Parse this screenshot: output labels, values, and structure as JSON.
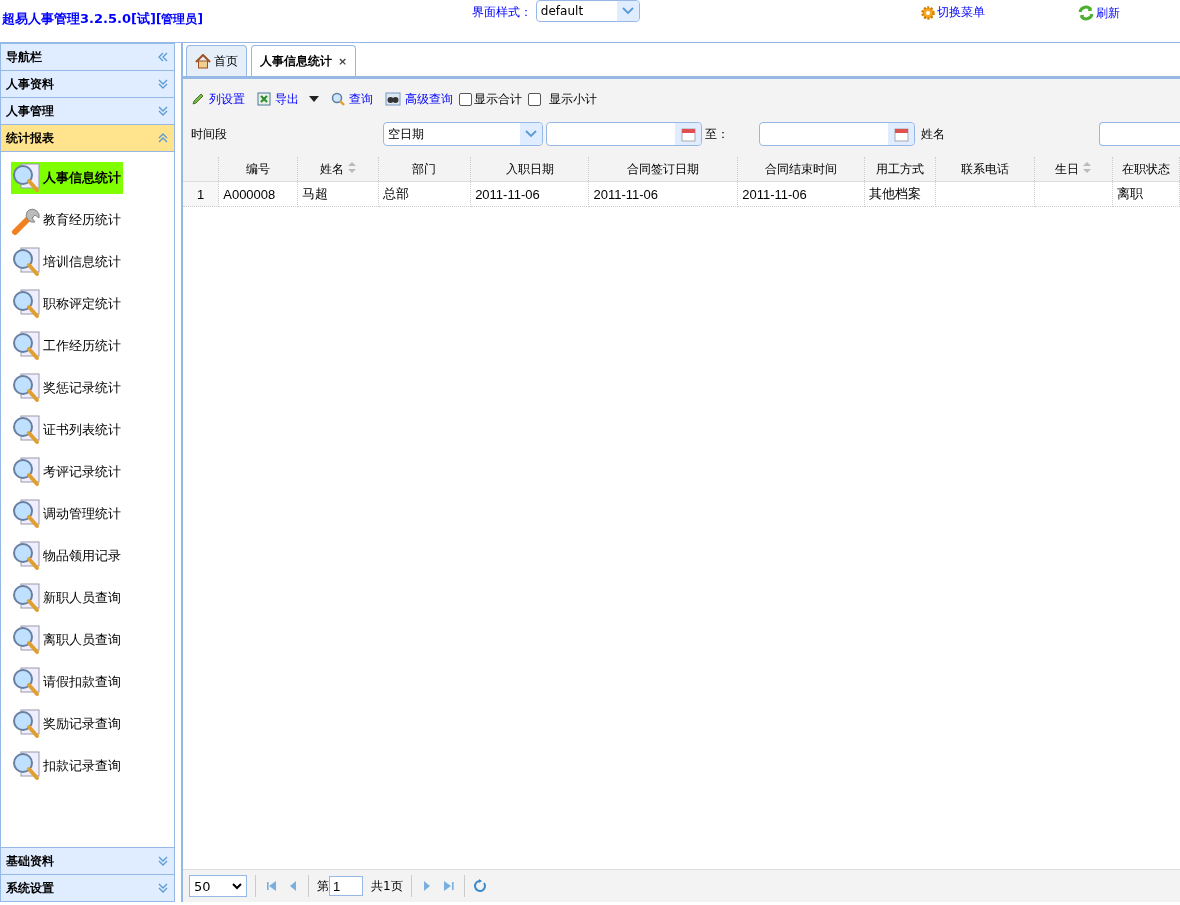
{
  "header": {
    "title": "超易人事管理3.2.5.0[试]",
    "role": "[管理员]",
    "style_label": "界面样式：",
    "style_value": "default",
    "links": [
      {
        "kind": "gear",
        "label": "切换菜单"
      },
      {
        "kind": "refresh",
        "label": "刷新"
      }
    ]
  },
  "sidebar": {
    "title": "导航栏",
    "panels_top": [
      {
        "label": "人事资料",
        "expanded": false
      },
      {
        "label": "人事管理",
        "expanded": false
      },
      {
        "label": "统计报表",
        "expanded": true
      }
    ],
    "items": [
      {
        "label": "人事信息统计",
        "kind": "search",
        "selected": true
      },
      {
        "label": "教育经历统计",
        "kind": "wrench",
        "selected": false
      },
      {
        "label": "培训信息统计",
        "kind": "search",
        "selected": false
      },
      {
        "label": "职称评定统计",
        "kind": "search",
        "selected": false
      },
      {
        "label": "工作经历统计",
        "kind": "search",
        "selected": false
      },
      {
        "label": "奖惩记录统计",
        "kind": "search",
        "selected": false
      },
      {
        "label": "证书列表统计",
        "kind": "search",
        "selected": false
      },
      {
        "label": "考评记录统计",
        "kind": "search",
        "selected": false
      },
      {
        "label": "调动管理统计",
        "kind": "search",
        "selected": false
      },
      {
        "label": "物品领用记录",
        "kind": "search",
        "selected": false
      },
      {
        "label": "新职人员查询",
        "kind": "search",
        "selected": false
      },
      {
        "label": "离职人员查询",
        "kind": "search",
        "selected": false
      },
      {
        "label": "请假扣款查询",
        "kind": "search",
        "selected": false
      },
      {
        "label": "奖励记录查询",
        "kind": "search",
        "selected": false
      },
      {
        "label": "扣款记录查询",
        "kind": "search",
        "selected": false
      }
    ],
    "panels_bottom": [
      {
        "label": "基础资料",
        "expanded": false
      },
      {
        "label": "系统设置",
        "expanded": false
      }
    ]
  },
  "tabs": [
    {
      "label": "首页",
      "kind": "home",
      "selected": false
    },
    {
      "label": "人事信息统计",
      "kind": "plain",
      "selected": true,
      "close": "×"
    }
  ],
  "toolbar": {
    "buttons": [
      {
        "kind": "pencil",
        "label": "列设置"
      },
      {
        "kind": "excel",
        "label": "导出",
        "dropdown": true
      },
      {
        "kind": "search",
        "label": "查询"
      },
      {
        "kind": "binoculars",
        "label": "高级查询"
      }
    ],
    "checkboxes": [
      {
        "label": "显示合计",
        "checked": false
      },
      {
        "label": "显示小计",
        "checked": false
      }
    ]
  },
  "filters": {
    "period_label": "时间段",
    "period_value": "空日期",
    "to_label": "至：",
    "name_label": "姓名"
  },
  "table": {
    "columns": [
      {
        "label": "编号",
        "sortable": false
      },
      {
        "label": "姓名",
        "sortable": true
      },
      {
        "label": "部门",
        "sortable": false
      },
      {
        "label": "入职日期",
        "sortable": false
      },
      {
        "label": "合同签订日期",
        "sortable": false
      },
      {
        "label": "合同结束时间",
        "sortable": false
      },
      {
        "label": "用工方式",
        "sortable": false
      },
      {
        "label": "联系电话",
        "sortable": false
      },
      {
        "label": "生日",
        "sortable": true
      },
      {
        "label": "在职状态",
        "sortable": false
      }
    ],
    "rows": [
      {
        "index": "1",
        "cells": [
          "A000008",
          "马超",
          "总部",
          "2011-11-06",
          "2011-11-06",
          "2011-11-06",
          "其他档案",
          "",
          "",
          "离职"
        ]
      }
    ]
  },
  "pager": {
    "page_size": "50",
    "page_prefix": "第",
    "page": "1",
    "total": "共1页"
  }
}
